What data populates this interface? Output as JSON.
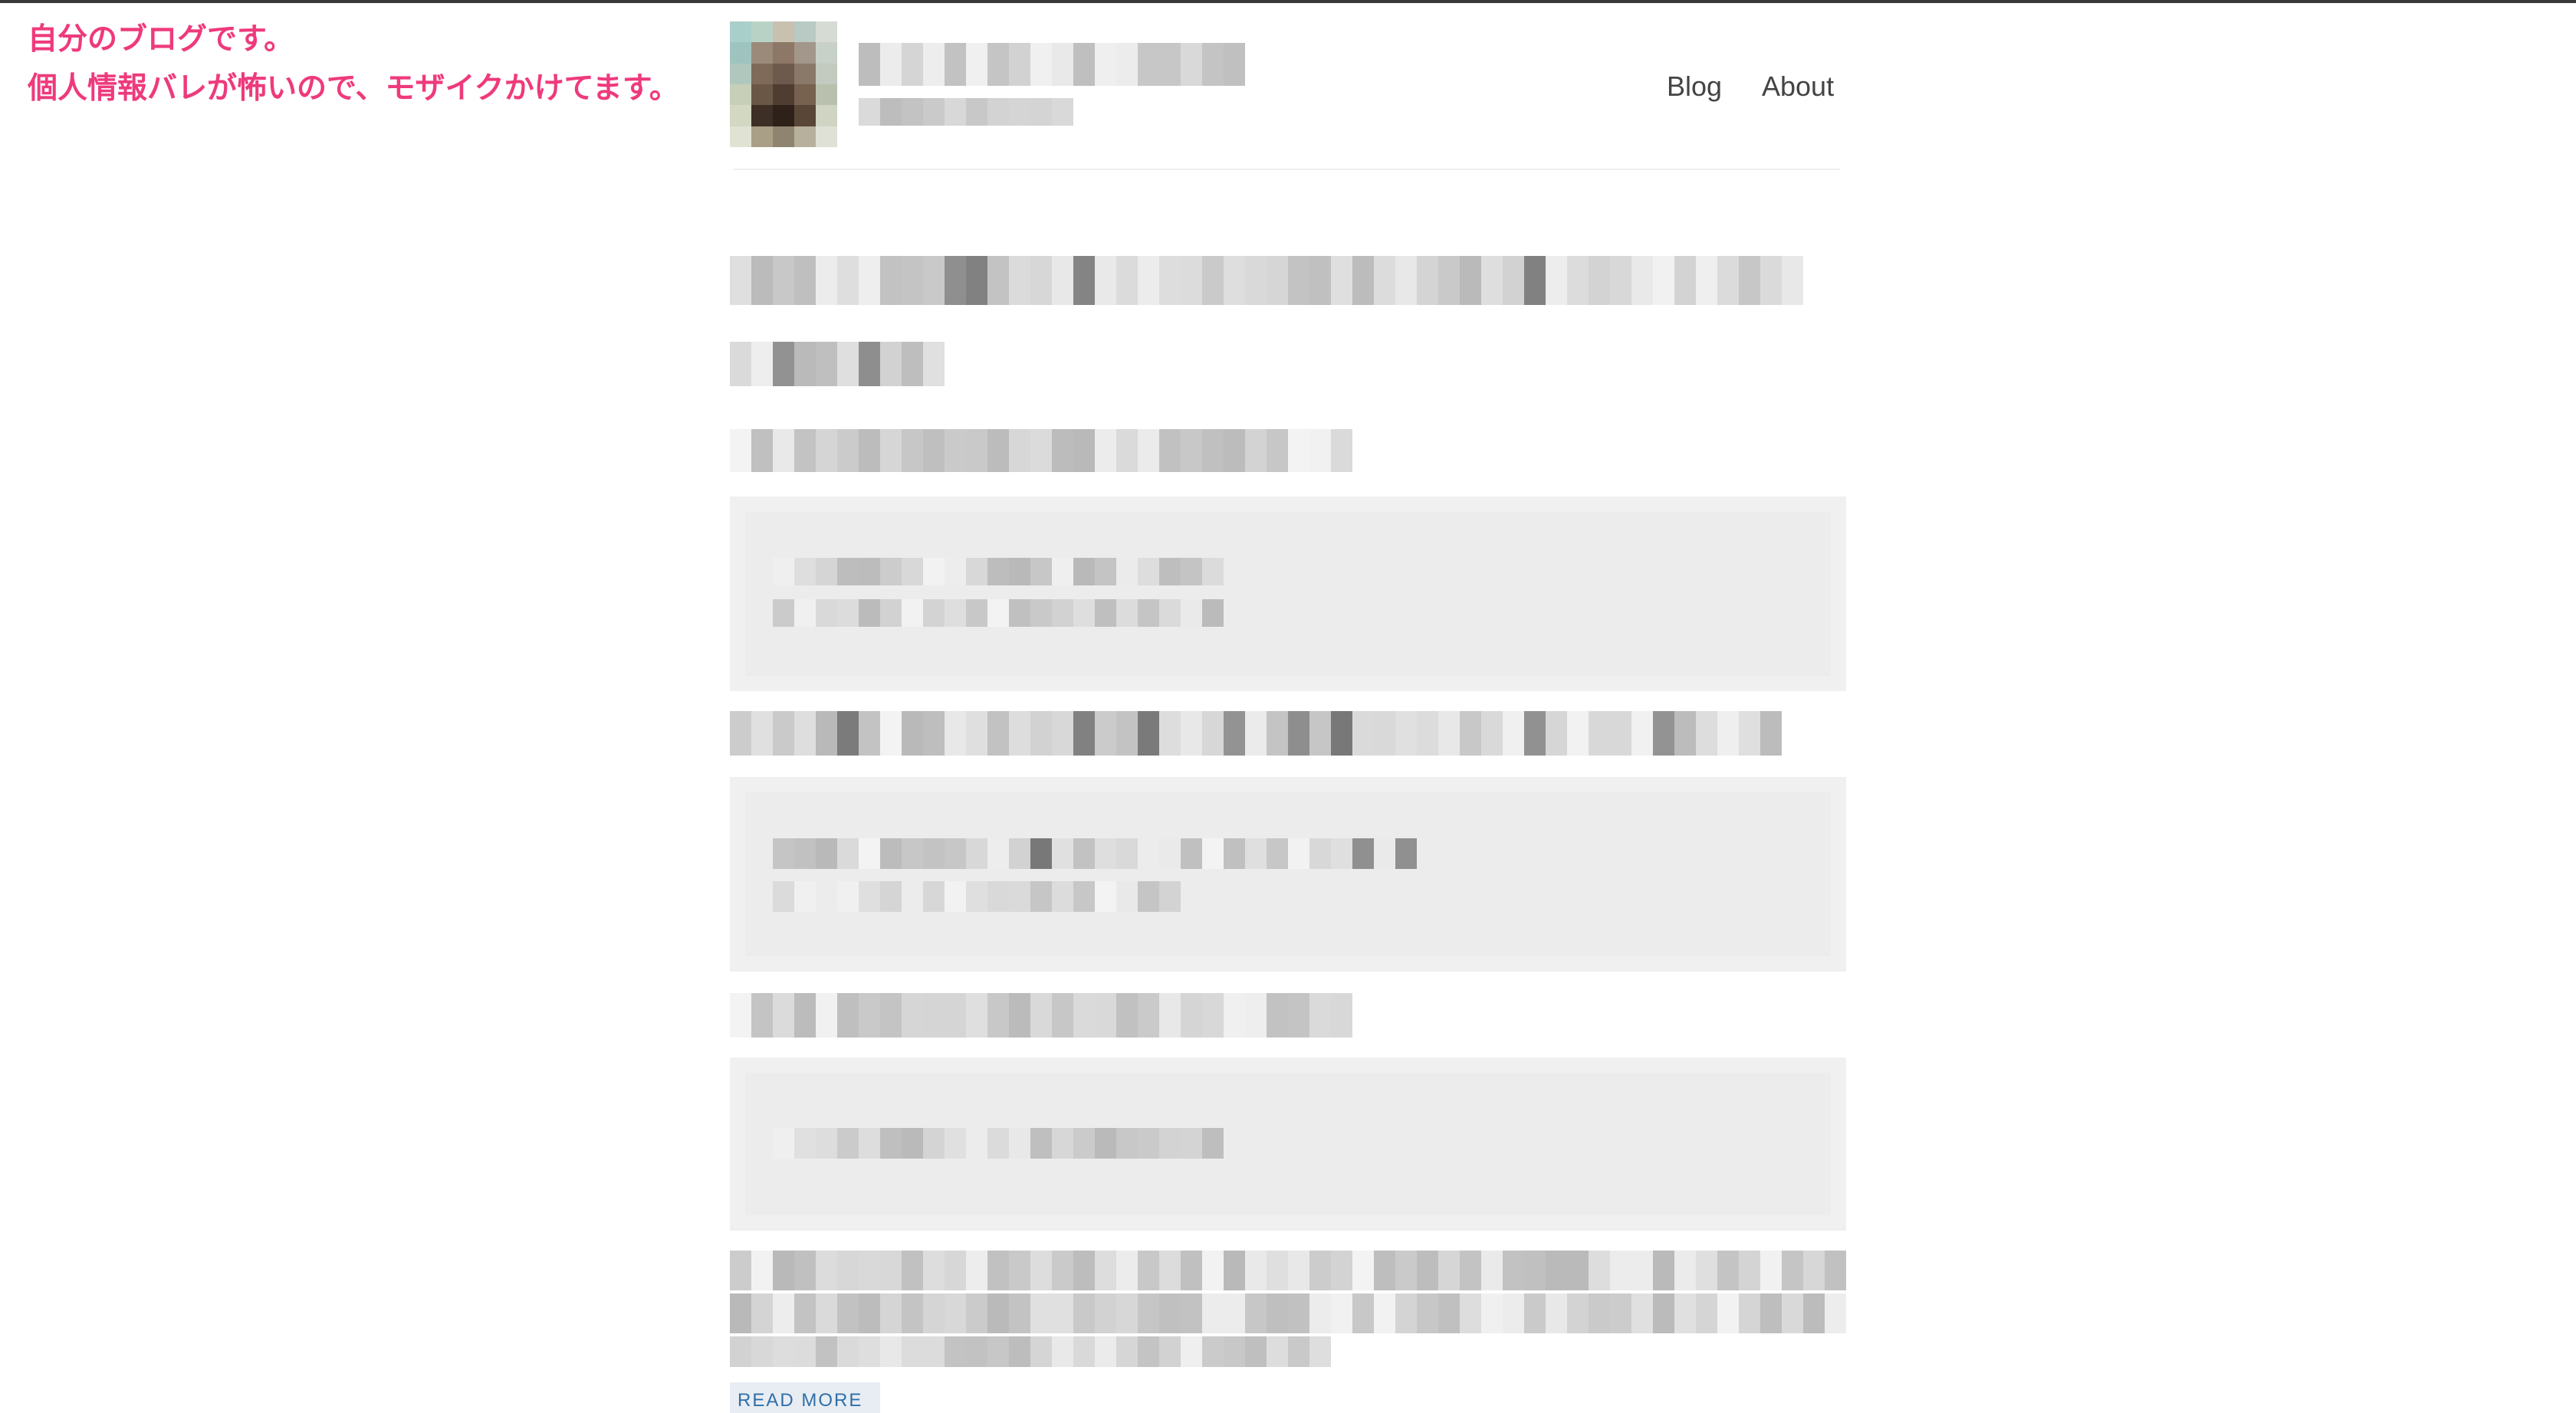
{
  "annotation": {
    "line1": "自分のブログです。",
    "line2": "個人情報バレが怖いので、モザイクかけてます。",
    "color": "#ee3a7c"
  },
  "header": {
    "avatar_icon": "pixelated-avatar",
    "nav": [
      {
        "label": "Blog"
      },
      {
        "label": "About"
      }
    ]
  },
  "post": {
    "read_more": "READ MORE"
  },
  "colors": {
    "mosaic_dark": "#8a8a8a",
    "mosaic_mid": "#c4c4c4",
    "mosaic_light": "#e2e2e2",
    "code_bg": "#ececec",
    "link": "#2f6fa8"
  }
}
